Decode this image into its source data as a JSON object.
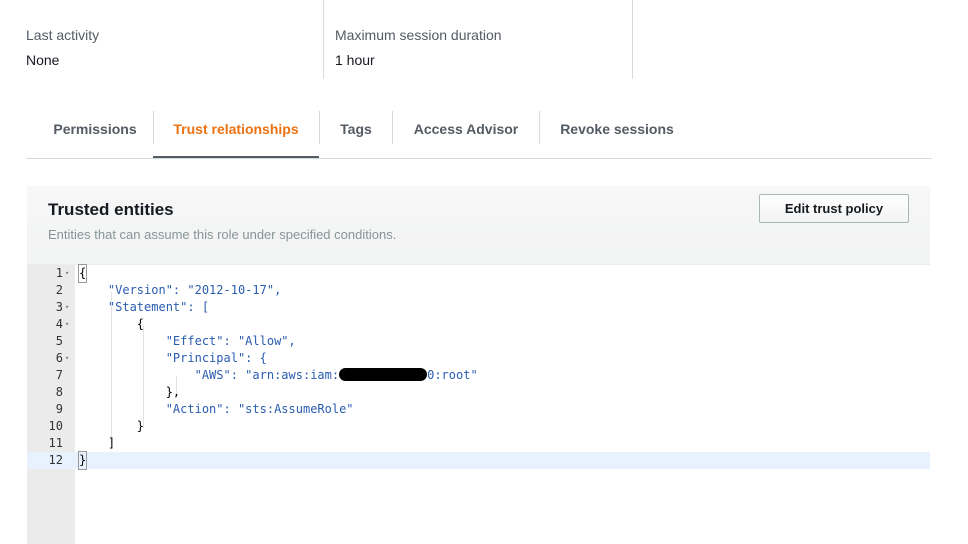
{
  "summary": {
    "last_activity_label": "Last activity",
    "last_activity_value": "None",
    "max_session_label": "Maximum session duration",
    "max_session_value": "1 hour"
  },
  "tabs": [
    {
      "label": "Permissions",
      "active": false
    },
    {
      "label": "Trust relationships",
      "active": true
    },
    {
      "label": "Tags",
      "active": false
    },
    {
      "label": "Access Advisor",
      "active": false
    },
    {
      "label": "Revoke sessions",
      "active": false
    }
  ],
  "trusted": {
    "title": "Trusted entities",
    "description": "Entities that can assume this role under specified conditions.",
    "edit_button": "Edit trust policy"
  },
  "editor": {
    "line_numbers": [
      "1",
      "2",
      "3",
      "4",
      "5",
      "6",
      "7",
      "8",
      "9",
      "10",
      "11",
      "12"
    ],
    "lines": [
      "{",
      "    \"Version\": \"2012-10-17\",",
      "    \"Statement\": [",
      "        {",
      "            \"Effect\": \"Allow\",",
      "            \"Principal\": {",
      "                \"AWS\": \"arn:aws:iam:",
      "            },",
      "            \"Action\": \"sts:AssumeRole\"",
      "        }",
      "    ]",
      "}"
    ],
    "line7_suffix": "0:root\"",
    "active_line": 12
  },
  "colors": {
    "accent_orange": "#ec7211",
    "json_key": "#2a5db0",
    "json_string": "#1a7b1a",
    "active_line_bg": "#e8f2fe"
  }
}
